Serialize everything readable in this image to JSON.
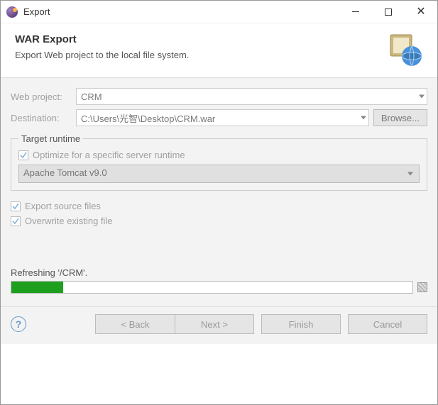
{
  "title": "Export",
  "header": {
    "title": "WAR Export",
    "description": "Export Web project to the local file system."
  },
  "form": {
    "webProjectLabel": "Web project:",
    "webProjectValue": "CRM",
    "destinationLabel": "Destination:",
    "destinationValue": "C:\\Users\\光智\\Desktop\\CRM.war",
    "browseLabel": "Browse..."
  },
  "targetRuntime": {
    "legend": "Target runtime",
    "optimizeLabel": "Optimize for a specific server runtime",
    "selected": "Apache Tomcat v9.0"
  },
  "options": {
    "exportSourceLabel": "Export source files",
    "overwriteLabel": "Overwrite existing file"
  },
  "progress": {
    "label": "Refreshing '/CRM'."
  },
  "buttons": {
    "back": "< Back",
    "next": "Next >",
    "finish": "Finish",
    "cancel": "Cancel"
  }
}
